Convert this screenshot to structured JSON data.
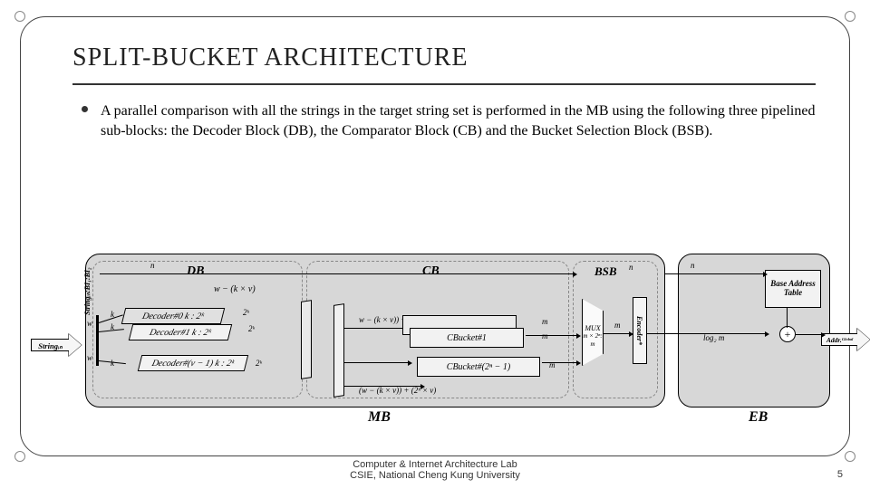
{
  "slide": {
    "title": "SPLIT-BUCKET ARCHITECTURE",
    "bullet_text": "A parallel comparison with all the strings in the target string set is performed in the MB using the following three pipelined sub-blocks: the Decoder Block (DB), the Comparator Block (CB) and the Bucket Selection Block (BSB).",
    "slide_number": "5",
    "footer_line1": "Computer & Internet Architecture Lab",
    "footer_line2": "CSIE, National Cheng Kung University"
  },
  "diagram": {
    "mb_block_label": "MB",
    "eb_block_label": "EB",
    "db_label": "DB",
    "cb_label": "CB",
    "bsb_label": "BSB",
    "input_arrow": "Stringᵢₙ",
    "output_arrow": "Addr.ᴳˡᵒᵇᵃˡ",
    "side_label": "Stringᵢₙ:BI₁:BI₂",
    "bus_n": "n",
    "bus_w": "w",
    "bus_k": "k",
    "bus_m": "m",
    "bus_2k": "2ᵏ",
    "expr_top": "w − (k × v)",
    "expr_mid": "w − (k × v)) + (2ᵏ × v)",
    "expr_low": "(w − (k × v)) + (2ᵏ × v)",
    "decoder0": "Decoder#0  k : 2ᵏ",
    "decoder1": "Decoder#1  k : 2ᵏ",
    "decoderv": "Decoder#(v − 1)  k : 2ᵏ",
    "cbucket1": "CBucket#1",
    "cbucketn": "CBucket#(2ⁿ − 1)",
    "mux": "MUX",
    "mux_sub": "m × 2ⁿ: m",
    "encoder": "Encoder*",
    "bat": "Base Address Table",
    "log2m": "log₂ m",
    "adder": "+"
  }
}
